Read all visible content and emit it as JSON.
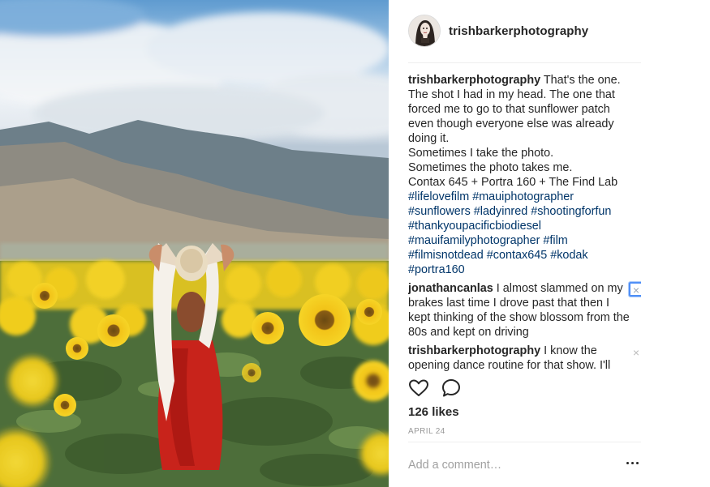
{
  "post": {
    "username": "trishbarkerphotography",
    "caption_user": "trishbarkerphotography",
    "caption_lines": [
      "That's the one. The shot I had in my head. The one that forced me to go to that sunflower patch even though everyone else was already doing it.",
      "Sometimes I take the photo.",
      "Sometimes the photo takes me.",
      "Contax 645 + Portra 160 + The Find Lab"
    ],
    "hashtags": [
      "#lifelovefilm",
      "#mauiphotographer",
      "#sunflowers",
      "#ladyinred",
      "#shootingforfun",
      "#thankyoupacificbiodiesel",
      "#mauifamilyphotographer",
      "#film",
      "#filmisnotdead",
      "#contax645",
      "#kodak",
      "#portra160"
    ],
    "comments": [
      {
        "user": "jonathancanlas",
        "text": "I almost slammed on my brakes last time I drove past that then I kept thinking of the show blossom from the 80s and kept on driving"
      },
      {
        "user": "trishbarkerphotography",
        "text": "I know the opening dance routine for that show. I'll"
      }
    ],
    "likes": "126 likes",
    "date": "APRIL 24",
    "comment_placeholder": "Add a comment…",
    "delete_glyph": "×"
  },
  "colors": {
    "hashtag": "#003569",
    "text": "#262626",
    "muted": "#999999",
    "divider": "#efefef",
    "focus_ring": "#4f8ff7"
  },
  "icons": [
    "avatar",
    "heart-icon",
    "comment-icon",
    "delete-icon",
    "more-options-icon"
  ]
}
